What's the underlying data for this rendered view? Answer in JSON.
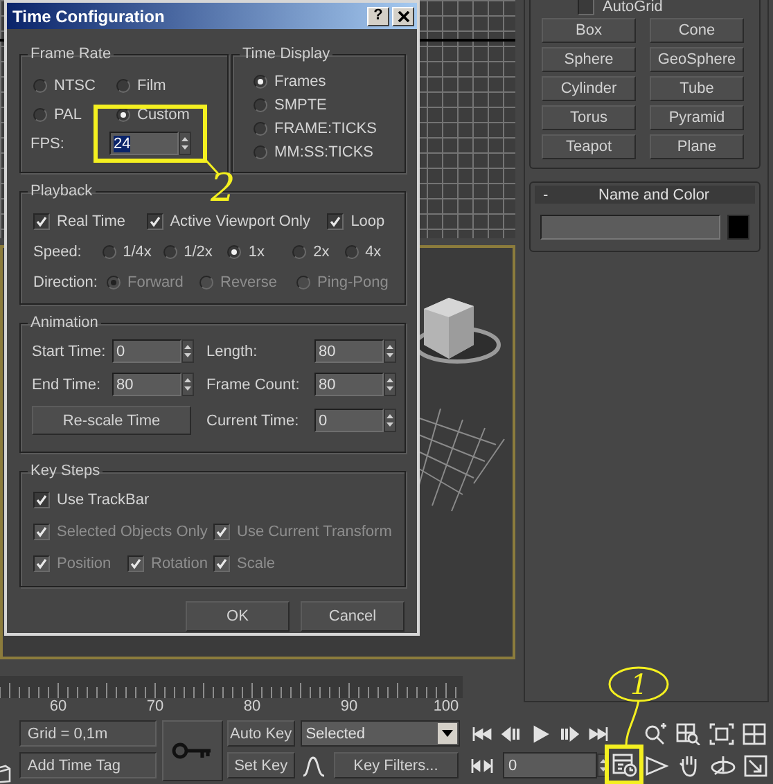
{
  "dialog": {
    "title": "Time Configuration",
    "help_button": "?",
    "frame_rate": {
      "title": "Frame Rate",
      "options": [
        {
          "label": "NTSC",
          "selected": false
        },
        {
          "label": "Film",
          "selected": false
        },
        {
          "label": "PAL",
          "selected": false
        },
        {
          "label": "Custom",
          "selected": true
        }
      ],
      "fps_label": "FPS:",
      "fps_value": "24",
      "fps_value_selected": true
    },
    "time_display": {
      "title": "Time Display",
      "options": [
        {
          "label": "Frames",
          "selected": true
        },
        {
          "label": "SMPTE",
          "selected": false
        },
        {
          "label": "FRAME:TICKS",
          "selected": false
        },
        {
          "label": "MM:SS:TICKS",
          "selected": false
        }
      ]
    },
    "playback": {
      "title": "Playback",
      "checkboxes": [
        {
          "label": "Real Time",
          "checked": true
        },
        {
          "label": "Active Viewport Only",
          "checked": true
        },
        {
          "label": "Loop",
          "checked": true
        }
      ],
      "speed_label": "Speed:",
      "speeds": [
        {
          "label": "1/4x",
          "selected": false
        },
        {
          "label": "1/2x",
          "selected": false
        },
        {
          "label": "1x",
          "selected": true
        },
        {
          "label": "2x",
          "selected": false
        },
        {
          "label": "4x",
          "selected": false
        }
      ],
      "direction_label": "Direction:",
      "directions": [
        {
          "label": "Forward",
          "selected": true,
          "disabled": true
        },
        {
          "label": "Reverse",
          "selected": false,
          "disabled": true
        },
        {
          "label": "Ping-Pong",
          "selected": false,
          "disabled": true
        }
      ]
    },
    "animation": {
      "title": "Animation",
      "fields": [
        {
          "label": "Start Time:",
          "value": "0"
        },
        {
          "label": "Length:",
          "value": "80"
        },
        {
          "label": "End Time:",
          "value": "80"
        },
        {
          "label": "Frame Count:",
          "value": "80"
        },
        {
          "label": "Current Time:",
          "value": "0"
        }
      ],
      "rescale_button": "Re-scale Time"
    },
    "key_steps": {
      "title": "Key Steps",
      "checkboxes": [
        {
          "label": "Use TrackBar",
          "checked": true,
          "disabled": false
        },
        {
          "label": "Selected Objects Only",
          "checked": true,
          "disabled": true
        },
        {
          "label": "Use Current Transform",
          "checked": true,
          "disabled": true
        },
        {
          "label": "Position",
          "checked": true,
          "disabled": true
        },
        {
          "label": "Rotation",
          "checked": true,
          "disabled": true
        },
        {
          "label": "Scale",
          "checked": true,
          "disabled": true
        }
      ]
    },
    "buttons": [
      "OK",
      "Cancel"
    ]
  },
  "command_panel": {
    "autogrid": {
      "label": "AutoGrid",
      "checked": false
    },
    "object_buttons": [
      "Box",
      "Cone",
      "Sphere",
      "GeoSphere",
      "Cylinder",
      "Tube",
      "Torus",
      "Pyramid",
      "Teapot",
      "Plane"
    ],
    "name_and_color": {
      "toggle": "-",
      "title": "Name and Color"
    }
  },
  "timeline": {
    "labels": [
      "60",
      "70",
      "80",
      "90",
      "100"
    ]
  },
  "status": {
    "grid": "Grid = 0,1m",
    "time_tag": "Add Time Tag"
  },
  "animation_controls": {
    "auto_key": "Auto Key",
    "set_key": "Set Key",
    "selection": "Selected",
    "key_filters": "Key Filters...",
    "current_frame": "0"
  },
  "annotations": [
    {
      "label": "2"
    },
    {
      "label": "1"
    }
  ]
}
